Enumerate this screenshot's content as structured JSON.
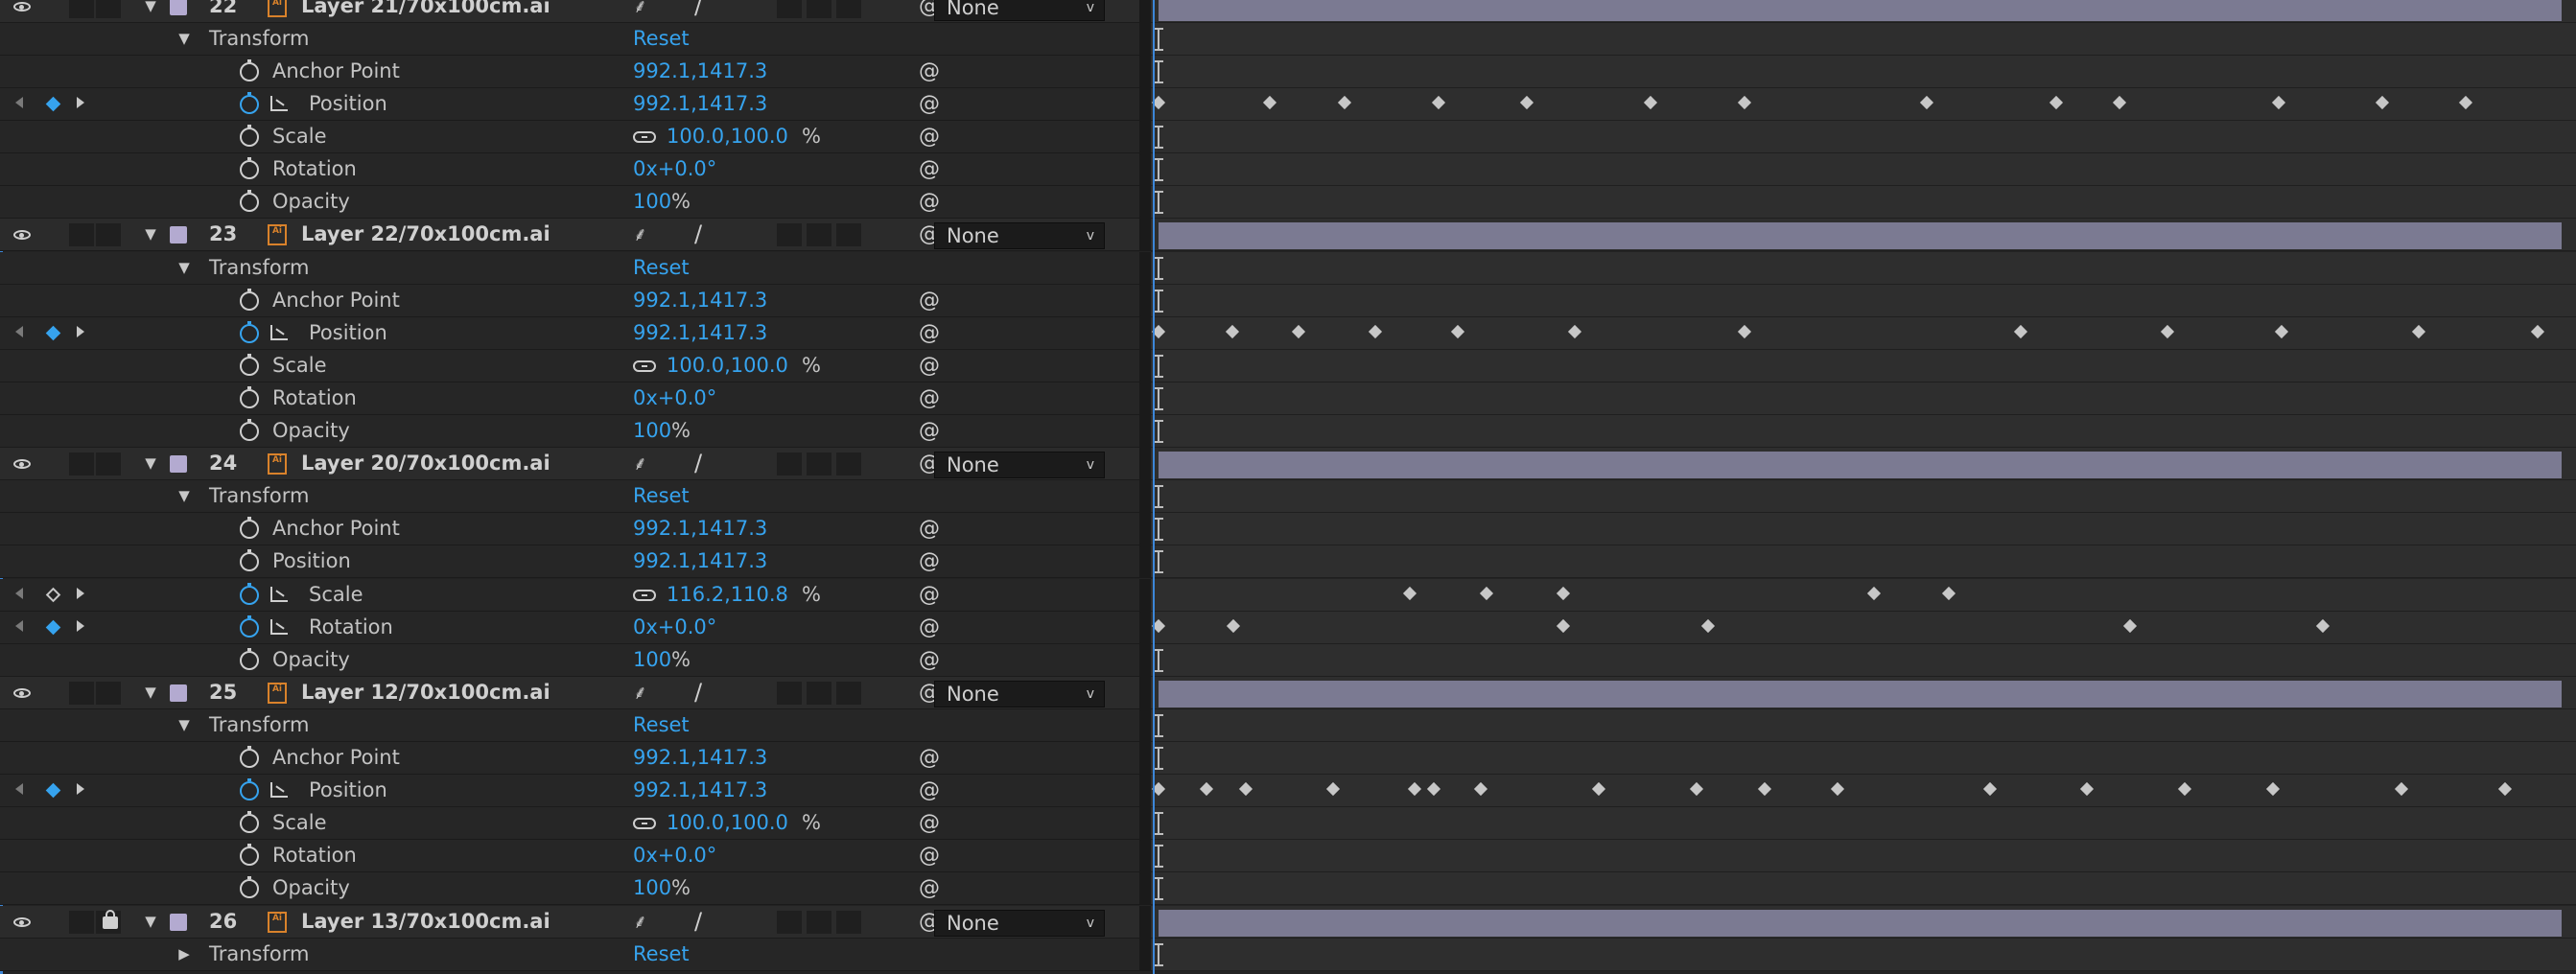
{
  "layers": [
    {
      "number": "22",
      "name": "Layer 21/70x100cm.ai",
      "blend_mode": "None",
      "ai_badge": "Ai",
      "locked": false,
      "transform_label": "Transform",
      "reset_label": "Reset",
      "properties": [
        {
          "label": "Anchor Point",
          "value": "992.1,1417.3",
          "suffix": "",
          "link": false,
          "animated": false,
          "keyframes": []
        },
        {
          "label": "Position",
          "value": "992.1,1417.3",
          "suffix": "",
          "link": false,
          "animated": true,
          "keyframes": [
            0,
            65,
            109,
            164,
            216,
            288,
            343,
            450,
            526,
            563,
            656,
            717,
            766
          ]
        },
        {
          "label": "Scale",
          "value": "100.0,100.0",
          "suffix": "%",
          "link": true,
          "animated": false,
          "keyframes": []
        },
        {
          "label": "Rotation",
          "value": "0x+0.0°",
          "suffix": "",
          "link": false,
          "animated": false,
          "keyframes": []
        },
        {
          "label": "Opacity",
          "value": "100",
          "suffix": "%",
          "link": false,
          "animated": false,
          "keyframes": []
        }
      ]
    },
    {
      "number": "23",
      "name": "Layer 22/70x100cm.ai",
      "blend_mode": "None",
      "ai_badge": "Ai",
      "locked": false,
      "transform_label": "Transform",
      "reset_label": "Reset",
      "properties": [
        {
          "label": "Anchor Point",
          "value": "992.1,1417.3",
          "suffix": "",
          "link": false,
          "animated": false,
          "keyframes": []
        },
        {
          "label": "Position",
          "value": "992.1,1417.3",
          "suffix": "",
          "link": false,
          "animated": true,
          "keyframes": [
            0,
            43,
            82,
            127,
            175,
            244,
            343,
            505,
            591,
            658,
            738,
            808
          ]
        },
        {
          "label": "Scale",
          "value": "100.0,100.0",
          "suffix": "%",
          "link": true,
          "animated": false,
          "keyframes": []
        },
        {
          "label": "Rotation",
          "value": "0x+0.0°",
          "suffix": "",
          "link": false,
          "animated": false,
          "keyframes": []
        },
        {
          "label": "Opacity",
          "value": "100",
          "suffix": "%",
          "link": false,
          "animated": false,
          "keyframes": []
        }
      ]
    },
    {
      "number": "24",
      "name": "Layer 20/70x100cm.ai",
      "blend_mode": "None",
      "ai_badge": "Ai",
      "locked": false,
      "transform_label": "Transform",
      "reset_label": "Reset",
      "properties": [
        {
          "label": "Anchor Point",
          "value": "992.1,1417.3",
          "suffix": "",
          "link": false,
          "animated": false,
          "keyframes": []
        },
        {
          "label": "Position",
          "value": "992.1,1417.3",
          "suffix": "",
          "link": false,
          "animated": false,
          "keyframes": []
        },
        {
          "label": "Scale",
          "value": "116.2,110.8",
          "suffix": "%",
          "link": true,
          "animated": true,
          "nav_hollow": true,
          "keyframes": [
            147,
            192,
            237,
            419,
            463
          ]
        },
        {
          "label": "Rotation",
          "value": "0x+0.0°",
          "suffix": "",
          "link": false,
          "animated": true,
          "keyframes": [
            0,
            44,
            237,
            322,
            569,
            682
          ]
        },
        {
          "label": "Opacity",
          "value": "100",
          "suffix": "%",
          "link": false,
          "animated": false,
          "keyframes": []
        }
      ]
    },
    {
      "number": "25",
      "name": "Layer 12/70x100cm.ai",
      "blend_mode": "None",
      "ai_badge": "Ai",
      "locked": false,
      "transform_label": "Transform",
      "reset_label": "Reset",
      "properties": [
        {
          "label": "Anchor Point",
          "value": "992.1,1417.3",
          "suffix": "",
          "link": false,
          "animated": false,
          "keyframes": []
        },
        {
          "label": "Position",
          "value": "992.1,1417.3",
          "suffix": "",
          "link": false,
          "animated": true,
          "keyframes": [
            0,
            28,
            51,
            102,
            150,
            161,
            189,
            258,
            315,
            355,
            398,
            487,
            544,
            601,
            653,
            728,
            789
          ]
        },
        {
          "label": "Scale",
          "value": "100.0,100.0",
          "suffix": "%",
          "link": true,
          "animated": false,
          "keyframes": []
        },
        {
          "label": "Rotation",
          "value": "0x+0.0°",
          "suffix": "",
          "link": false,
          "animated": false,
          "keyframes": []
        },
        {
          "label": "Opacity",
          "value": "100",
          "suffix": "%",
          "link": false,
          "animated": false,
          "keyframes": []
        }
      ]
    },
    {
      "number": "26",
      "name": "Layer 13/70x100cm.ai",
      "blend_mode": "None",
      "ai_badge": "Ai",
      "locked": true,
      "transform_label": "Transform",
      "reset_label": "Reset",
      "collapsed": true,
      "properties": []
    }
  ],
  "icons": {
    "eye": "eye-icon",
    "stopwatch": "stopwatch-icon",
    "graph": "graph-icon",
    "link": "link-icon",
    "spiral": "pick-whip-icon",
    "lock": "lock-icon",
    "shy": "shy-icon",
    "quality": "quality-slash-icon"
  },
  "glyphs": {
    "expanded": "▼",
    "collapsed": "▶",
    "chevron": "⌄",
    "spiral": "@",
    "shy": "⸙"
  },
  "colors": {
    "value_blue": "#36a3ee",
    "layer_label": "#b3aad0",
    "layer_bar": "#7b7a92",
    "ai_orange": "#d9822b"
  }
}
